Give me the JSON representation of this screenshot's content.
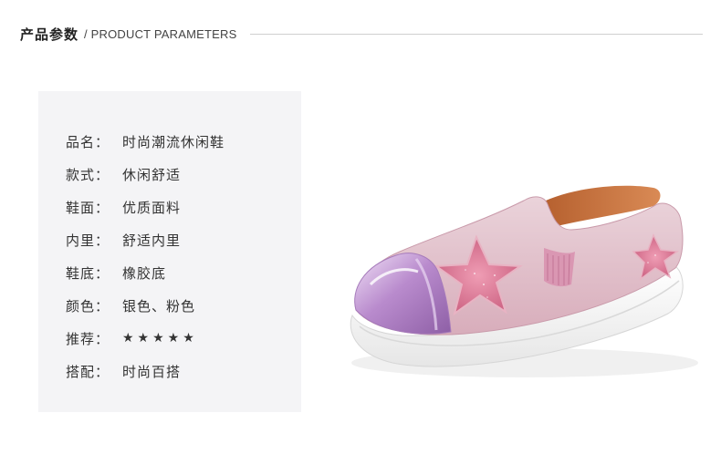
{
  "header": {
    "title_cn": "产品参数",
    "title_en": "/ PRODUCT PARAMETERS"
  },
  "params": [
    {
      "label": "品名：",
      "value": "时尚潮流休闲鞋"
    },
    {
      "label": "款式：",
      "value": "休闲舒适"
    },
    {
      "label": "鞋面：",
      "value": "优质面料"
    },
    {
      "label": "内里：",
      "value": "舒适内里"
    },
    {
      "label": "鞋底：",
      "value": "橡胶底"
    },
    {
      "label": "颜色：",
      "value": "银色、粉色"
    },
    {
      "label": "推荐：",
      "value": "★★★★★"
    },
    {
      "label": "搭配：",
      "value": "时尚百搭"
    }
  ],
  "rating": {
    "stars": 5,
    "max": 5
  },
  "colors": {
    "panel_bg": "#f4f4f6",
    "shoe_upper": "#e6c7d0",
    "shoe_glitter": "#d77b95",
    "toe_metallic": "#c9a0d8",
    "sole": "#f7f7f7"
  },
  "image": {
    "icon": "pink-star-slip-on-shoe"
  }
}
